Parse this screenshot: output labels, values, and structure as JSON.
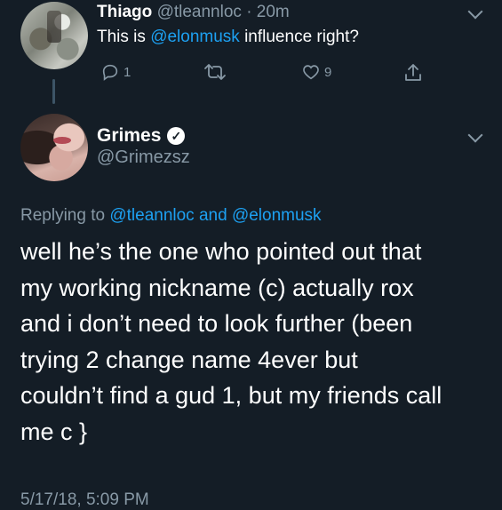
{
  "tweet1": {
    "name": "Thiago",
    "handle": "@tleannloc",
    "separator": "·",
    "time": "20m",
    "text_prefix": "This is ",
    "mention": "@elonmusk",
    "text_suffix": " influence right?",
    "reply_count": "1",
    "like_count": "9",
    "icons": [
      "reply-icon",
      "retweet-icon",
      "heart-icon",
      "share-icon",
      "chevron-down-icon"
    ]
  },
  "tweet2": {
    "name": "Grimes",
    "handle": "@Grimezsz",
    "replying_label": "Replying to ",
    "replying_user1": "@tleannloc",
    "replying_and": " and ",
    "replying_user2": "@elonmusk",
    "body_lines": [
      "well he’s the one who pointed out that",
      "my working nickname (c) actually rox",
      "and i don’t need to look further (been",
      "trying 2 change name 4ever but",
      "couldn’t find a gud 1, but my friends call",
      "me c }"
    ],
    "date": "5/17/18, 5:09 PM",
    "icons": [
      "verified-icon",
      "chevron-down-icon"
    ]
  },
  "colors": {
    "background": "#141d26",
    "link": "#1da1f2",
    "muted": "#8899a6",
    "text": "#ffffff"
  }
}
